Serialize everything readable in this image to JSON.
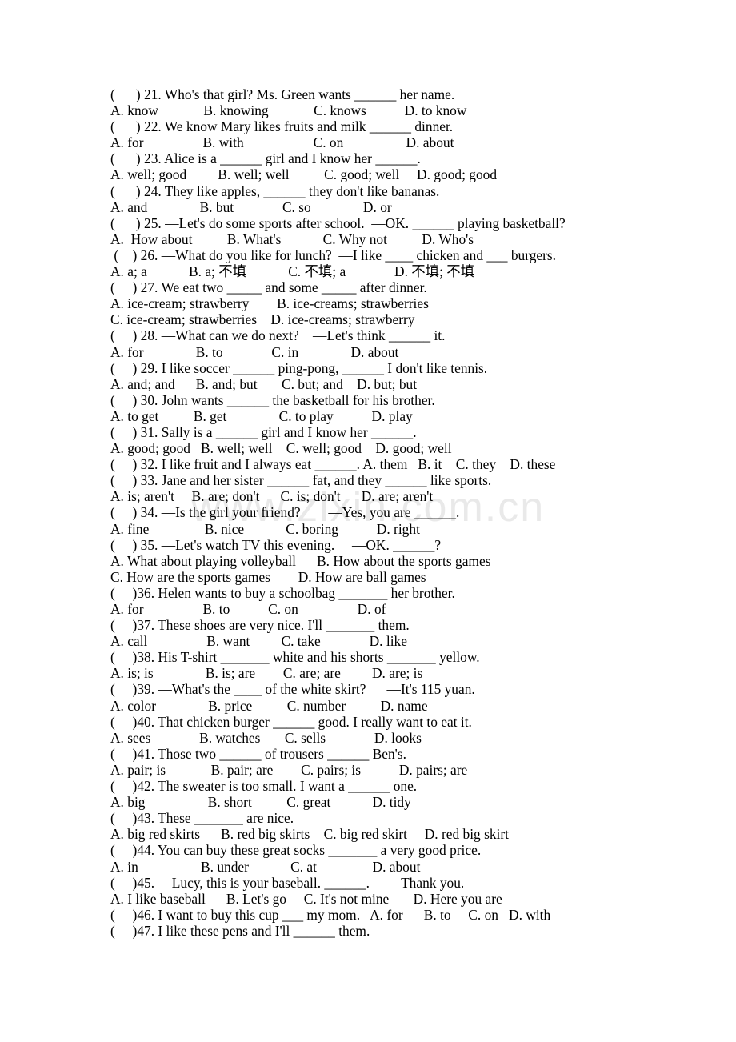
{
  "document": {
    "type": "english-grammar-multiple-choice-worksheet",
    "watermark": "www.zixin.com.cn",
    "first_question": 21,
    "last_question": 47
  },
  "lines": [
    {
      "id": "q21-stem",
      "text": "(      ) 21. Who's that girl? Ms. Green wants ______ her name."
    },
    {
      "id": "q21-options",
      "text": "A. know             B. knowing             C. knows           D. to know"
    },
    {
      "id": "q22-stem",
      "text": "(      ) 22. We know Mary likes fruits and milk ______ dinner."
    },
    {
      "id": "q22-options",
      "text": "A. for                 B. with                    C. on                  D. about"
    },
    {
      "id": "q23-stem",
      "text": "(      ) 23. Alice is a ______ girl and I know her ______."
    },
    {
      "id": "q23-options",
      "text": "A. well; good         B. well; well          C. good; well     D. good; good"
    },
    {
      "id": "q24-stem",
      "text": "(      ) 24. They like apples, ______ they don't like bananas."
    },
    {
      "id": "q24-options",
      "text": "A. and               B. but              C. so               D. or"
    },
    {
      "id": "q25-stem",
      "text": "(      ) 25. —Let's do some sports after school.  —OK. ______ playing basketball?"
    },
    {
      "id": "q25-options",
      "text": "A.  How about          B. What's            C. Why not          D. Who's"
    },
    {
      "id": "q26-stem",
      "text": " (    ) 26. —What do you like for lunch?  —I like ____ chicken and ___ burgers."
    },
    {
      "id": "q26-options",
      "text": "A. a; a            B. a; 不填            C. 不填; a              D. 不填; 不填"
    },
    {
      "id": "q27-stem",
      "text": "(     ) 27. We eat two _____ and some _____ after dinner."
    },
    {
      "id": "q27-opt-ab",
      "text": "A. ice-cream; strawberry        B. ice-creams; strawberries"
    },
    {
      "id": "q27-opt-cd",
      "text": "C. ice-cream; strawberries    D. ice-creams; strawberry"
    },
    {
      "id": "q28-stem",
      "text": "(     ) 28. —What can we do next?    —Let's think ______ it."
    },
    {
      "id": "q28-options",
      "text": "A. for               B. to              C. in               D. about"
    },
    {
      "id": "q29-stem",
      "text": "(     ) 29. I like soccer ______ ping-pong, ______ I don't like tennis."
    },
    {
      "id": "q29-options",
      "text": "A. and; and      B. and; but       C. but; and    D. but; but"
    },
    {
      "id": "q30-stem",
      "text": "(     ) 30. John wants ______ the basketball for his brother."
    },
    {
      "id": "q30-options",
      "text": "A. to get          B. get               C. to play           D. play"
    },
    {
      "id": "q31-stem",
      "text": "(     ) 31. Sally is a ______ girl and I know her ______."
    },
    {
      "id": "q31-options",
      "text": "A. good; good   B. well; well    C. well; good    D. good; well"
    },
    {
      "id": "q32-line",
      "text": "(     ) 32. I like fruit and I always eat ______. A. them   B. it    C. they    D. these"
    },
    {
      "id": "q33-stem",
      "text": "(     ) 33. Jane and her sister ______ fat, and they ______ like sports."
    },
    {
      "id": "q33-options",
      "text": "A. is; aren't     B. are; don't      C. is; don't      D. are; aren't"
    },
    {
      "id": "q34-stem",
      "text": "(     ) 34. —Is the girl your friend?        —Yes, you are ______."
    },
    {
      "id": "q34-options",
      "text": "A. fine                B. nice            C. boring           D. right"
    },
    {
      "id": "q35-stem",
      "text": "(     ) 35. —Let's watch TV this evening.     —OK. ______?"
    },
    {
      "id": "q35-opt-ab",
      "text": "A. What about playing volleyball      B. How about the sports games"
    },
    {
      "id": "q35-opt-cd",
      "text": "C. How are the sports games        D. How are ball games"
    },
    {
      "id": "q36-stem",
      "text": "(     )36. Helen wants to buy a schoolbag _______ her brother."
    },
    {
      "id": "q36-options",
      "text": "A. for                 B. to           C. on                 D. of"
    },
    {
      "id": "q37-stem",
      "text": "(     )37. These shoes are very nice. I'll _______ them."
    },
    {
      "id": "q37-options",
      "text": "A. call                 B. want         C. take              D. like"
    },
    {
      "id": "q38-stem",
      "text": "(     )38. His T-shirt _______ white and his shorts _______ yellow."
    },
    {
      "id": "q38-options",
      "text": "A. is; is               B. is; are        C. are; are         D. are; is"
    },
    {
      "id": "q39-stem",
      "text": "(     )39. —What's the ____ of the white skirt?      —It's 115 yuan."
    },
    {
      "id": "q39-options",
      "text": "A. color               B. price          C. number          D. name"
    },
    {
      "id": "q40-stem",
      "text": "(     )40. That chicken burger ______ good. I really want to eat it."
    },
    {
      "id": "q40-options",
      "text": "A. sees              B. watches       C. sells              D. looks"
    },
    {
      "id": "q41-stem",
      "text": "(     )41. Those two ______ of trousers ______ Ben's."
    },
    {
      "id": "q41-options",
      "text": "A. pair; is             B. pair; are        C. pairs; is           D. pairs; are"
    },
    {
      "id": "q42-stem",
      "text": "(     )42. The sweater is too small. I want a ______ one."
    },
    {
      "id": "q42-options",
      "text": "A. big                  B. short          C. great            D. tidy"
    },
    {
      "id": "q43-stem",
      "text": "(     )43. These _______ are nice."
    },
    {
      "id": "q43-options",
      "text": "A. big red skirts      B. red big skirts    C. big red skirt     D. red big skirt"
    },
    {
      "id": "q44-stem",
      "text": "(     )44. You can buy these great socks _______ a very good price."
    },
    {
      "id": "q44-options",
      "text": "A. in                  B. under            C. at                D. about"
    },
    {
      "id": "q45-stem",
      "text": "(     )45. —Lucy, this is your baseball. ______.     —Thank you."
    },
    {
      "id": "q45-options",
      "text": "A. I like baseball      B. Let's go     C. It's not mine       D. Here you are"
    },
    {
      "id": "q46-line",
      "text": "(     )46. I want to buy this cup ___ my mom.   A. for      B. to     C. on   D. with"
    },
    {
      "id": "q47-stem",
      "text": "(     )47. I like these pens and I'll ______ them."
    }
  ]
}
